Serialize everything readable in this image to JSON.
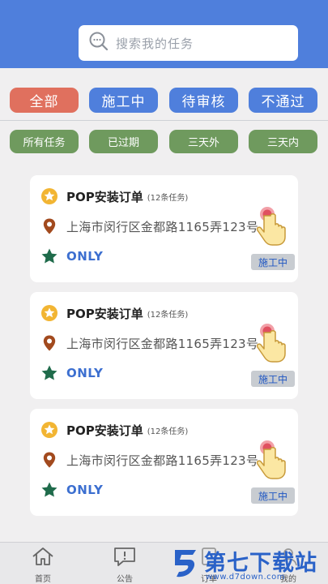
{
  "search": {
    "placeholder": "搜索我的任务"
  },
  "status_tabs": [
    "全部",
    "施工中",
    "待审核",
    "不通过"
  ],
  "filters": [
    "所有任务",
    "已过期",
    "三天外",
    "三天内"
  ],
  "orders": [
    {
      "title": "POP安装订单",
      "count": "(12条任务)",
      "address": "上海市闵行区金都路1165弄123号",
      "note": "ONLY",
      "status": "施工中"
    },
    {
      "title": "POP安装订单",
      "count": "(12条任务)",
      "address": "上海市闵行区金都路1165弄123号",
      "note": "ONLY",
      "status": "施工中"
    },
    {
      "title": "POP安装订单",
      "count": "(12条任务)",
      "address": "上海市闵行区金都路1165弄123号",
      "note": "ONLY",
      "status": "施工中"
    }
  ],
  "tabbar": [
    {
      "label": "首页",
      "icon": "home-icon"
    },
    {
      "label": "公告",
      "icon": "notice-icon"
    },
    {
      "label": "订单",
      "icon": "order-icon"
    },
    {
      "label": "我的",
      "icon": "profile-icon"
    }
  ],
  "watermark": {
    "name": "第七下载站",
    "url": "www.d7down.com"
  },
  "colors": {
    "header": "#4f7fdc",
    "active_tab": "#e0705e",
    "filter": "#6f9a5e",
    "status_text": "#1f56c2"
  }
}
